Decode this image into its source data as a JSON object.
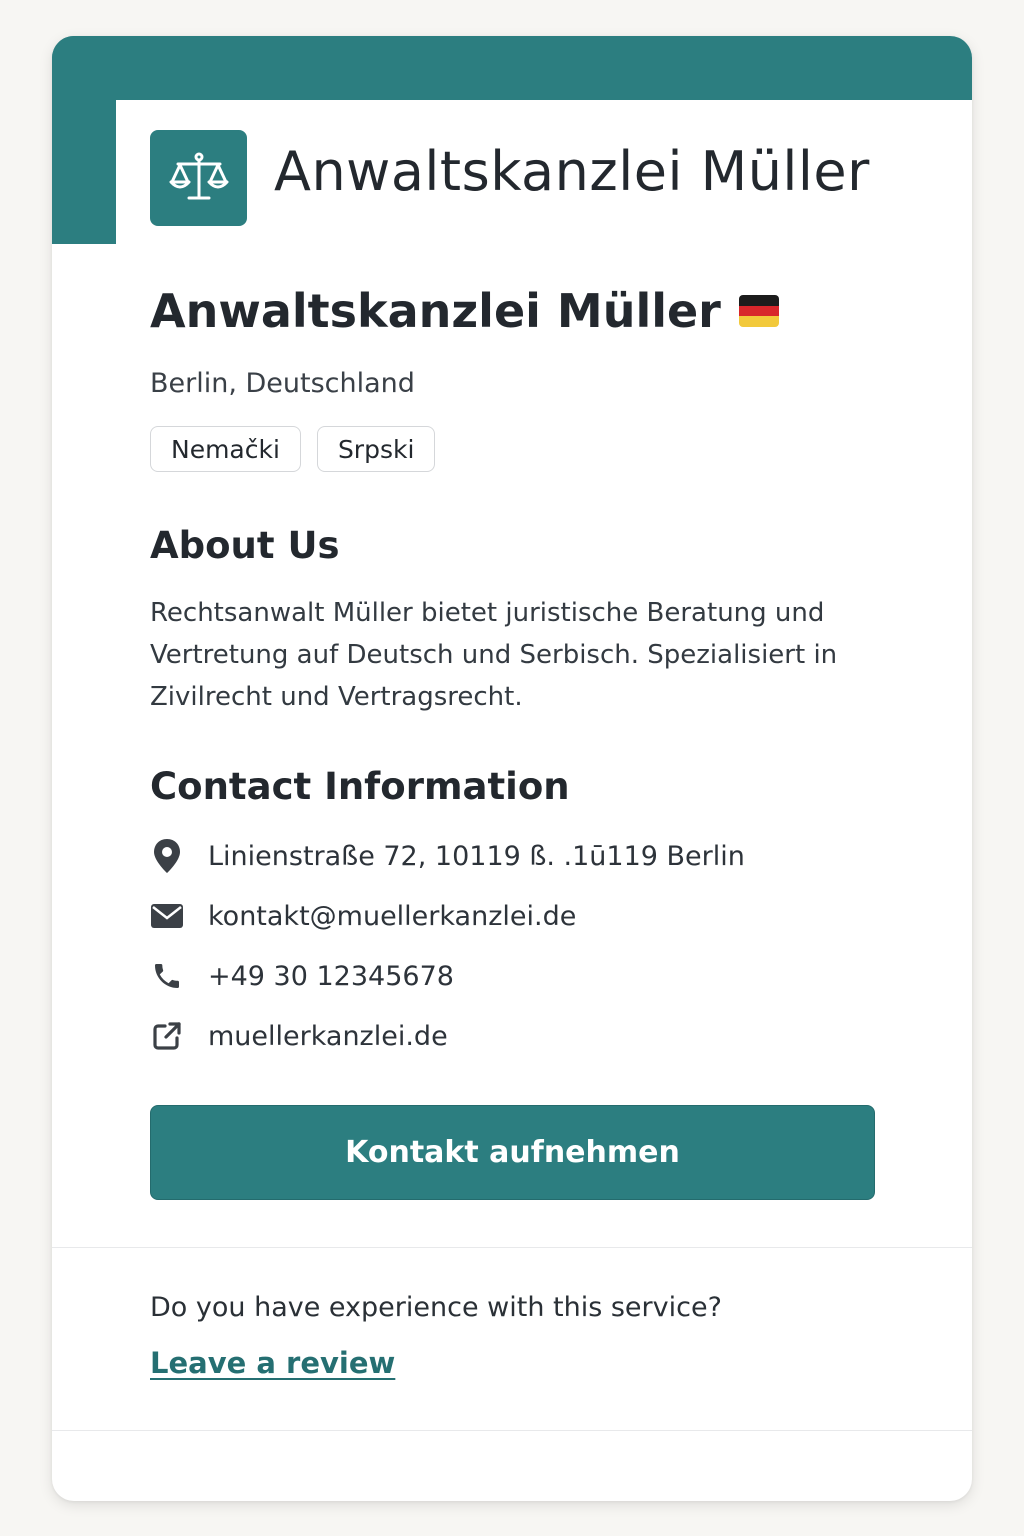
{
  "header": {
    "brand_title": "Anwaltskanzlei Müller",
    "logo_icon": "scales-icon",
    "accent_color": "#2c7e80"
  },
  "profile": {
    "name": "Anwaltskanzlei Müller",
    "flag_icon": "germany-flag-icon",
    "location": "Berlin, Deutschland",
    "languages": [
      "Nemački",
      "Srpski"
    ]
  },
  "about": {
    "heading": "About Us",
    "text": "Rechtsanwalt Müller bietet juristische Beratung und Vertretung auf Deutsch und Serbisch. Spezialisiert in Zivilrecht und Vertragsrecht."
  },
  "contact": {
    "heading": "Contact Information",
    "items": [
      {
        "icon": "location-pin-icon",
        "text": "Linienstraße 72, 10119 ß. .1ū119 Berlin"
      },
      {
        "icon": "email-icon",
        "text": "kontakt@muellerkanzlei.de"
      },
      {
        "icon": "phone-icon",
        "text": "+49 30 12345678"
      },
      {
        "icon": "external-link-icon",
        "text": "muellerkanzlei.de"
      }
    ],
    "cta_label": "Kontakt aufnehmen"
  },
  "review": {
    "question": "Do you have experience with this service?",
    "link_label": "Leave a review"
  }
}
